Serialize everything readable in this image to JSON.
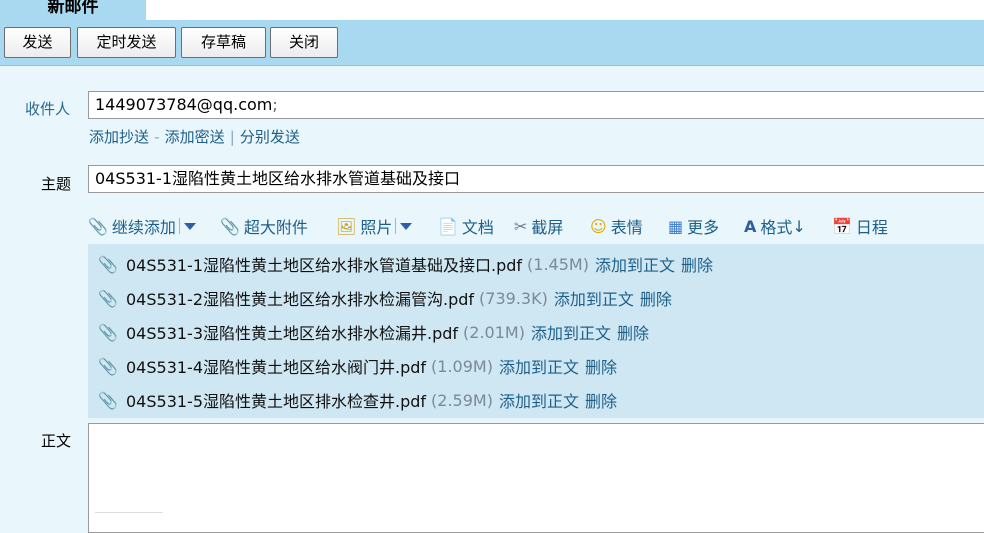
{
  "tab": {
    "label": "新邮件"
  },
  "toolbar": {
    "send": "发送",
    "scheduled_send": "定时发送",
    "save_draft": "存草稿",
    "close": "关闭"
  },
  "recipient": {
    "label": "收件人",
    "value": "1449073784@qq.com",
    "suffix": ";"
  },
  "recipient_links": {
    "add_cc": "添加抄送",
    "dash": "-",
    "add_bcc": "添加密送",
    "pipe": "|",
    "separate_send": "分别发送"
  },
  "subject": {
    "label": "主题",
    "value": "04S531-1湿陷性黄土地区给水排水管道基础及接口"
  },
  "attach_bar": {
    "continue_add": "继续添加",
    "big_attach": "超大附件",
    "photo": "照片",
    "document": "文档",
    "screenshot": "截屏",
    "emoji": "表情",
    "more": "更多",
    "format": "格式",
    "format_arrow": "↓",
    "schedule": "日程"
  },
  "attachments": [
    {
      "name": "04S531-1湿陷性黄土地区给水排水管道基础及接口.pdf",
      "size": "(1.45M)",
      "add_to_body": "添加到正文",
      "delete": "删除"
    },
    {
      "name": "04S531-2湿陷性黄土地区给水排水检漏管沟.pdf",
      "size": "(739.3K)",
      "add_to_body": "添加到正文",
      "delete": "删除"
    },
    {
      "name": "04S531-3湿陷性黄土地区给水排水检漏井.pdf",
      "size": "(2.01M)",
      "add_to_body": "添加到正文",
      "delete": "删除"
    },
    {
      "name": "04S531-4湿陷性黄土地区给水阀门井.pdf",
      "size": "(1.09M)",
      "add_to_body": "添加到正文",
      "delete": "删除"
    },
    {
      "name": "04S531-5湿陷性黄土地区排水检查井.pdf",
      "size": "(2.59M)",
      "add_to_body": "添加到正文",
      "delete": "删除"
    }
  ],
  "body": {
    "label": "正文"
  },
  "colors": {
    "toolbar_bg": "#a8d9f0",
    "page_bg": "#e9f6fc",
    "link": "#1e5f8a",
    "attachment_list_bg": "#cfe7f3"
  }
}
